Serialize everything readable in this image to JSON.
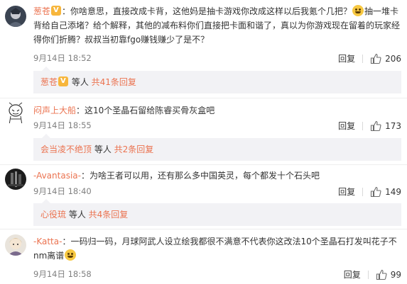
{
  "comments": [
    {
      "username": "葱苍",
      "text": "：你啥意思，直接改成卡背，这他妈是抽卡游戏你改成这样以后我氪个几把？",
      "text_cont": "抽一堆卡背给自己添堵？给个解释，其他的减布料你们直接把卡面和谐了，真以为你游戏现在留着的玩家经得你们折腾？叔叔当初靠fgo赚钱赚少了是不？",
      "time": "9月14日 18:52",
      "reply_label": "回复",
      "likes": "206",
      "sub": {
        "user": "葱苍",
        "mid": " 等人 ",
        "count": "共41条回复"
      }
    },
    {
      "username": "闷声上大船",
      "text": "：这10个圣晶石留给陈睿买骨灰盒吧",
      "time": "9月14日 18:55",
      "reply_label": "回复",
      "likes": "173",
      "sub": {
        "user": "会当凌不绝顶",
        "mid": " 等人 ",
        "count": "共2条回复"
      }
    },
    {
      "username": "-Avantasia-",
      "text": "：为啥王者可以用，还有那么多中国英灵，每个都发十个石头吧",
      "time": "9月14日 18:40",
      "reply_label": "回复",
      "likes": "149",
      "sub": {
        "user": "心役琉",
        "mid": " 等人 ",
        "count": "共4条回复"
      }
    },
    {
      "username": "-Katta-",
      "text": "：一码归一码，月球阿武人设立绘我都很不满意不代表你这改法10个圣晶石打发叫花子不nm离谱",
      "time": "9月14日 18:58",
      "reply_label": "回复",
      "likes": "99"
    }
  ],
  "colors": {
    "accent": "#eb7350",
    "sub_bg": "#f2f2f5",
    "time": "#808080"
  }
}
